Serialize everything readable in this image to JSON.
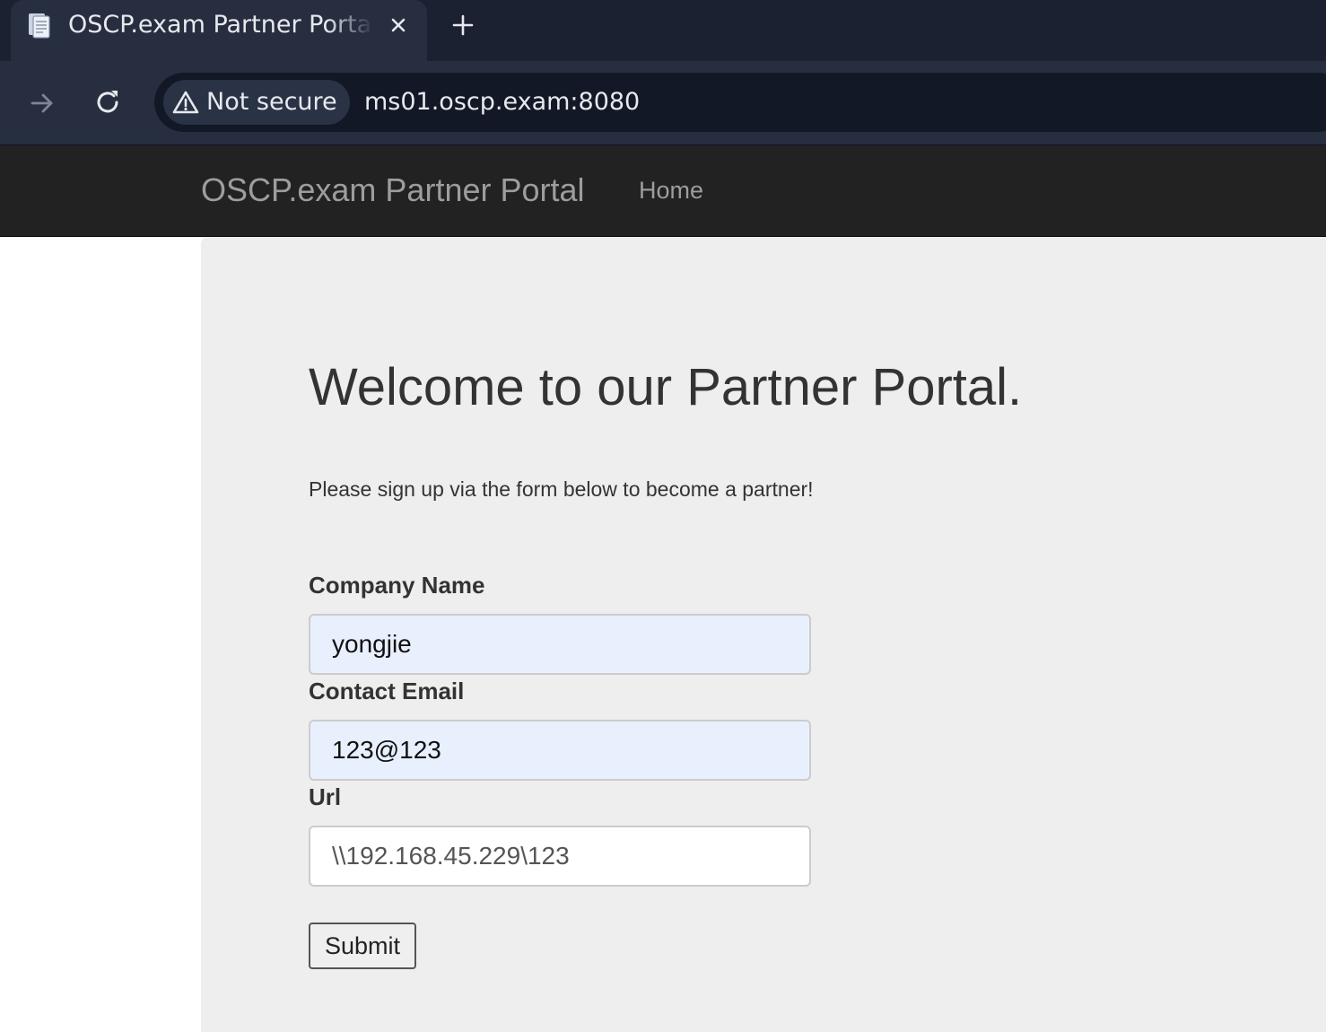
{
  "browser": {
    "tab": {
      "title": "OSCP.exam Partner Portal",
      "favicon": "document-icon"
    },
    "new_tab_icon": "plus-icon",
    "toolbar": {
      "forward_icon": "arrow-right-icon",
      "reload_icon": "reload-icon"
    },
    "address_bar": {
      "security_label": "Not secure",
      "url": "ms01.oscp.exam:8080"
    }
  },
  "navbar": {
    "brand": "OSCP.exam Partner Portal",
    "links": [
      {
        "label": "Home"
      }
    ]
  },
  "main": {
    "heading": "Welcome to our Partner Portal.",
    "lead": "Please sign up via the form below to become a partner!",
    "form": {
      "fields": [
        {
          "label": "Company Name",
          "value": "yongjie",
          "autofilled": true
        },
        {
          "label": "Contact Email",
          "value": "123@123",
          "autofilled": true
        },
        {
          "label": "Url",
          "value": "\\\\192.168.45.229\\123",
          "autofilled": false
        }
      ],
      "submit_label": "Submit"
    }
  },
  "colors": {
    "tabstrip_bg": "#1b2131",
    "toolbar_bg": "#262e40",
    "navbar_bg": "#222222",
    "jumbotron_bg": "#eeeeee",
    "autofill_bg": "#e8f0fe"
  }
}
